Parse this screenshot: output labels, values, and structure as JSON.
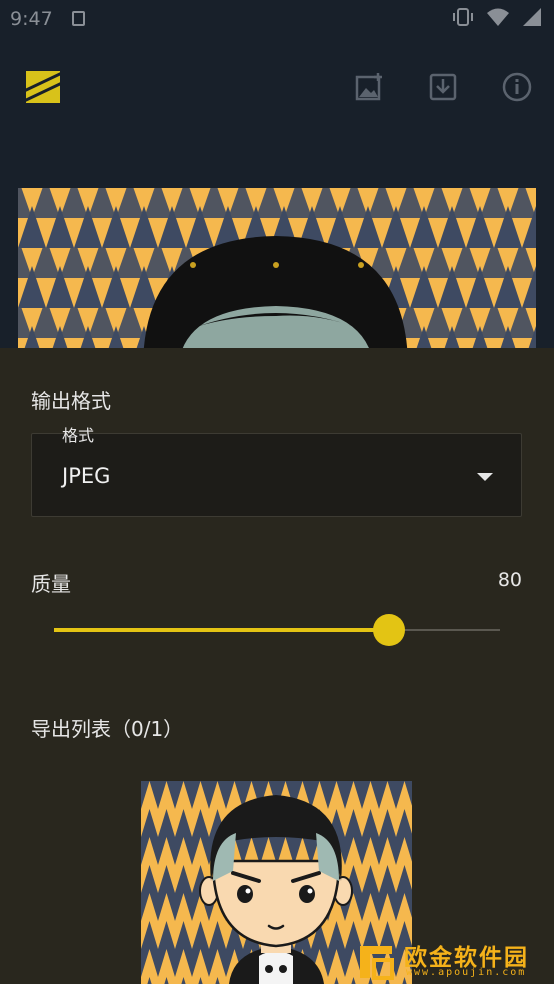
{
  "status_bar": {
    "time": "9:47"
  },
  "app_bar": {
    "logo_icon": "app-logo",
    "actions": [
      "add-image-icon",
      "download-icon",
      "info-icon"
    ]
  },
  "sheet": {
    "output_format_title": "输出格式",
    "format_field": {
      "label": "格式",
      "value": "JPEG"
    },
    "quality": {
      "label": "质量",
      "value": "80",
      "fraction": 0.75
    },
    "export_list_title": "导出列表（0/1）"
  },
  "watermark": {
    "title": "欧金软件园",
    "url": "www.apoujin.com"
  },
  "colors": {
    "accent": "#e3c414",
    "sheet_bg": "#29271e",
    "app_bg": "#18202a",
    "pattern_navy": "#3e4a62",
    "pattern_amber": "#f5b84e"
  }
}
